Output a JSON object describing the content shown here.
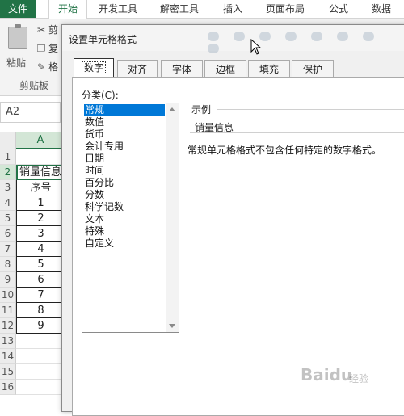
{
  "ribbon": {
    "tabs": [
      "文件",
      "开始",
      "开发工具",
      "解密工具",
      "插入",
      "页面布局",
      "公式",
      "数据"
    ],
    "active_tab": "开始",
    "paste_label": "粘贴",
    "cut_label": "剪",
    "copy_label": "复",
    "format_painter_label": "格",
    "clipboard_group": "剪贴板",
    "accent": "#217346"
  },
  "name_box": {
    "value": "A2"
  },
  "sheet": {
    "column_header": "A",
    "row_numbers": [
      "1",
      "2",
      "3",
      "4",
      "5",
      "6",
      "7",
      "8",
      "9",
      "10",
      "11",
      "12",
      "13",
      "14",
      "15",
      "16"
    ],
    "cells": [
      "",
      "销量信息",
      "序号",
      "1",
      "2",
      "3",
      "4",
      "5",
      "6",
      "7",
      "8",
      "9",
      "",
      "",
      "",
      ""
    ]
  },
  "dialog": {
    "title": "设置单元格格式",
    "tabs": [
      "数字",
      "对齐",
      "字体",
      "边框",
      "填充",
      "保护"
    ],
    "active_tab": "数字",
    "category_label": "分类(C):",
    "categories": [
      "常规",
      "数值",
      "货币",
      "会计专用",
      "日期",
      "时间",
      "百分比",
      "分数",
      "科学记数",
      "文本",
      "特殊",
      "自定义"
    ],
    "selected_category": "常规",
    "sample_label": "示例",
    "sample_value": "销量信息",
    "description": "常规单元格格式不包含任何特定的数字格式。",
    "selection_color": "#0078d7"
  },
  "watermark": {
    "text": "Baidu",
    "sub": "经验"
  }
}
